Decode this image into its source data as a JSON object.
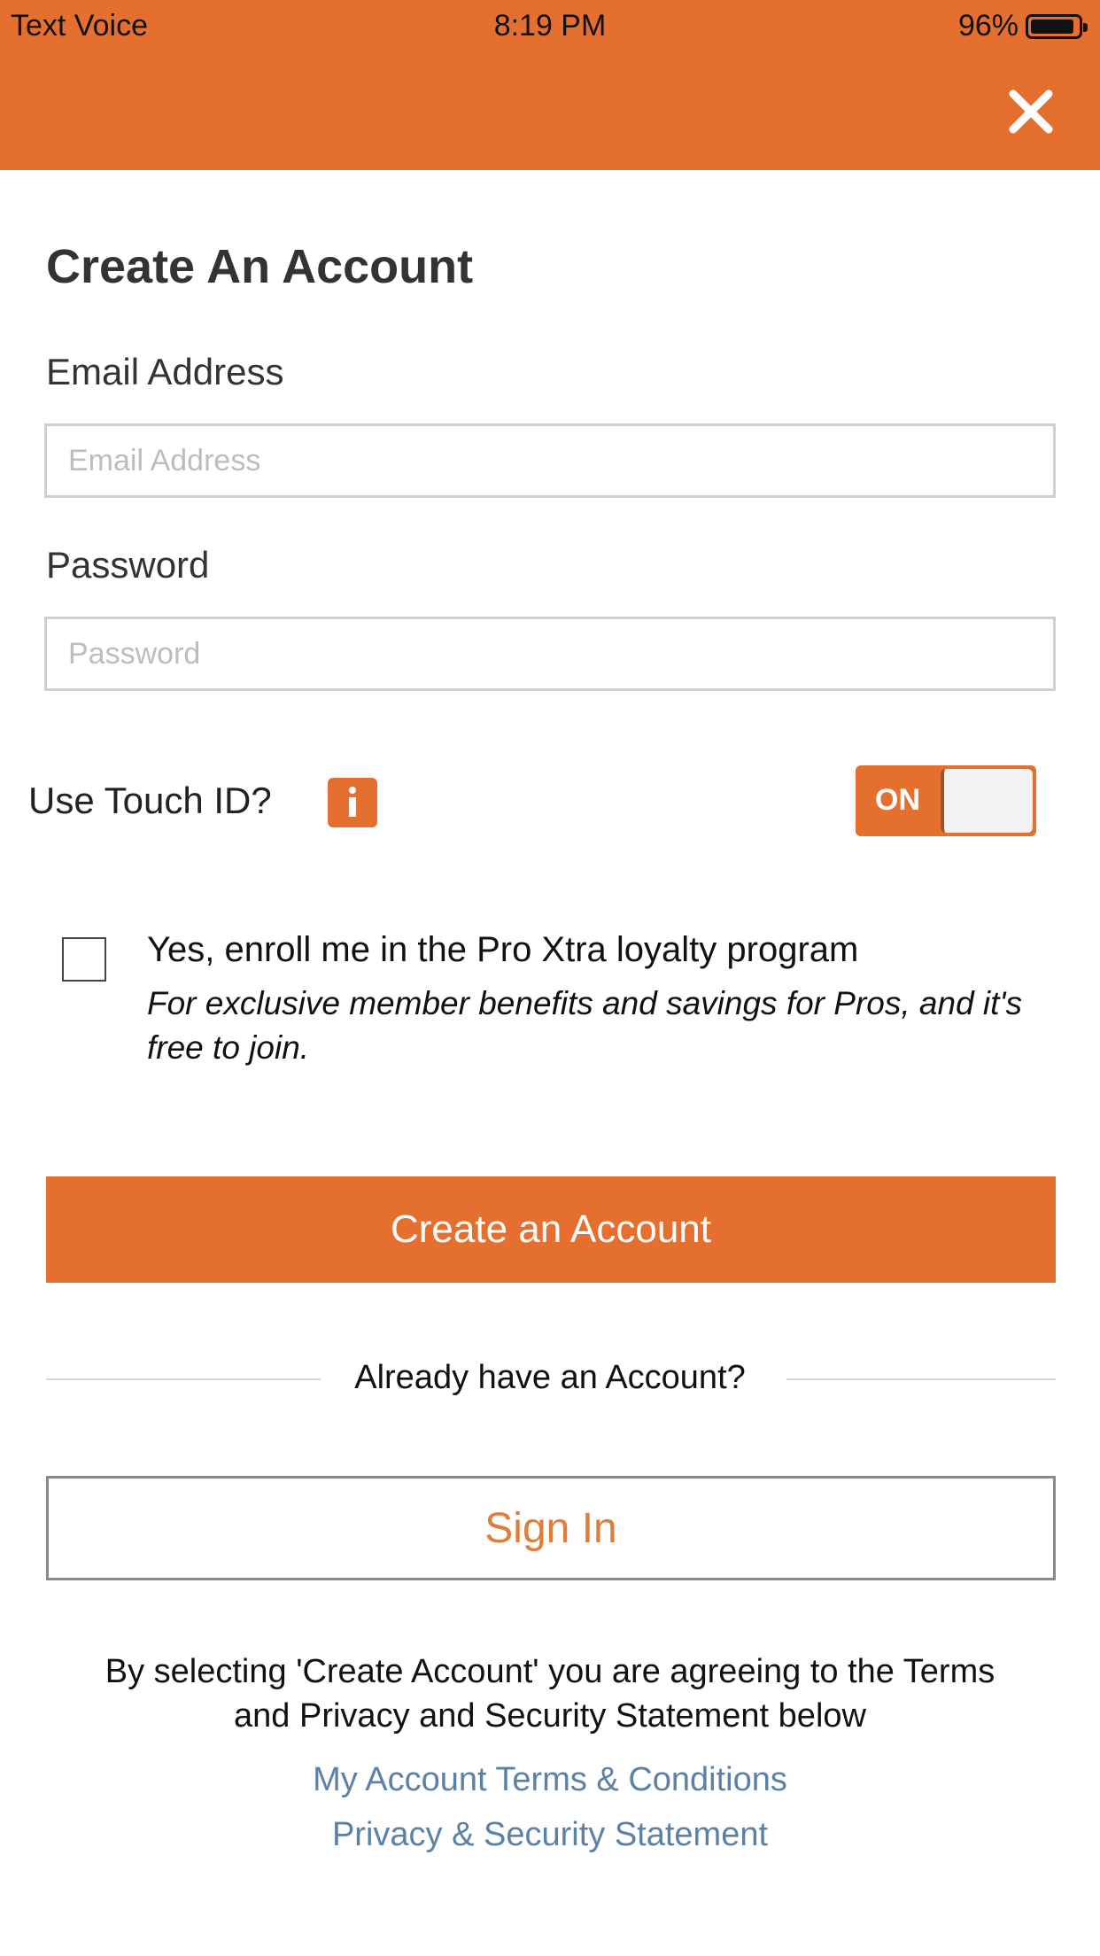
{
  "status_bar": {
    "left": "Text Voice",
    "time": "8:19 PM",
    "battery": "96%",
    "battery_level": 0.96
  },
  "header": {
    "close_icon": "close-icon"
  },
  "page": {
    "title": "Create An Account"
  },
  "form": {
    "email_label": "Email Address",
    "email_placeholder": "Email Address",
    "email_value": "",
    "password_label": "Password",
    "password_placeholder": "Password",
    "password_value": ""
  },
  "touch_id": {
    "label": "Use Touch ID?",
    "info_icon": "info-icon",
    "toggle_text": "ON",
    "enabled": true
  },
  "loyalty": {
    "checked": false,
    "title": "Yes, enroll me in the Pro Xtra loyalty program",
    "description": "For exclusive member benefits and savings for Pros, and it's free to join."
  },
  "buttons": {
    "create": "Create an Account",
    "divider": "Already have an Account?",
    "sign_in": "Sign In"
  },
  "footer": {
    "agreement": "By selecting 'Create Account' you are agreeing to the Terms and Privacy and Security Statement below",
    "terms_link": "My Account Terms & Conditions",
    "privacy_link": "Privacy & Security Statement"
  },
  "colors": {
    "brand": "#e56f2e",
    "link": "#5b82a6"
  }
}
